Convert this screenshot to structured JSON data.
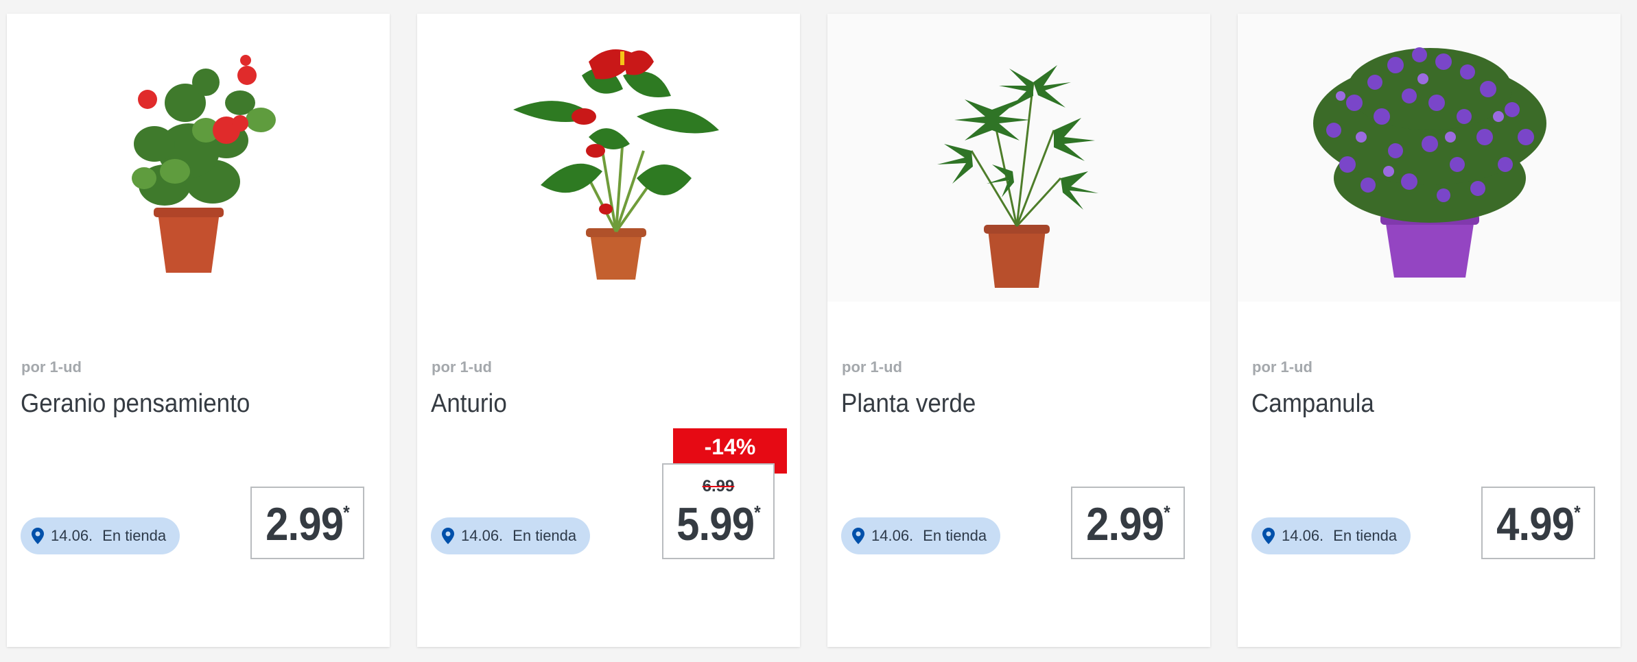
{
  "products": [
    {
      "unit": "por 1-ud",
      "name": "Geranio pensamiento",
      "date": "14.06.",
      "availability": "En tienda",
      "price": "2.99",
      "asterisk": "*",
      "image_icon": "potted-geranium-icon"
    },
    {
      "unit": "por 1-ud",
      "name": "Anturio",
      "date": "14.06.",
      "availability": "En tienda",
      "price": "5.99",
      "asterisk": "*",
      "old_price": "6.99",
      "discount": "-14%",
      "image_icon": "potted-anthurium-icon"
    },
    {
      "unit": "por 1-ud",
      "name": "Planta verde",
      "date": "14.06.",
      "availability": "En tienda",
      "price": "2.99",
      "asterisk": "*",
      "image_icon": "potted-green-plant-icon"
    },
    {
      "unit": "por 1-ud",
      "name": "Campanula",
      "date": "14.06.",
      "availability": "En tienda",
      "price": "4.99",
      "asterisk": "*",
      "image_icon": "potted-campanula-icon"
    }
  ],
  "colors": {
    "discount": "#e60a14",
    "badge": "#c8ddf5",
    "pin": "#0050aa",
    "text": "#353b42",
    "muted": "#a4a8ac"
  }
}
